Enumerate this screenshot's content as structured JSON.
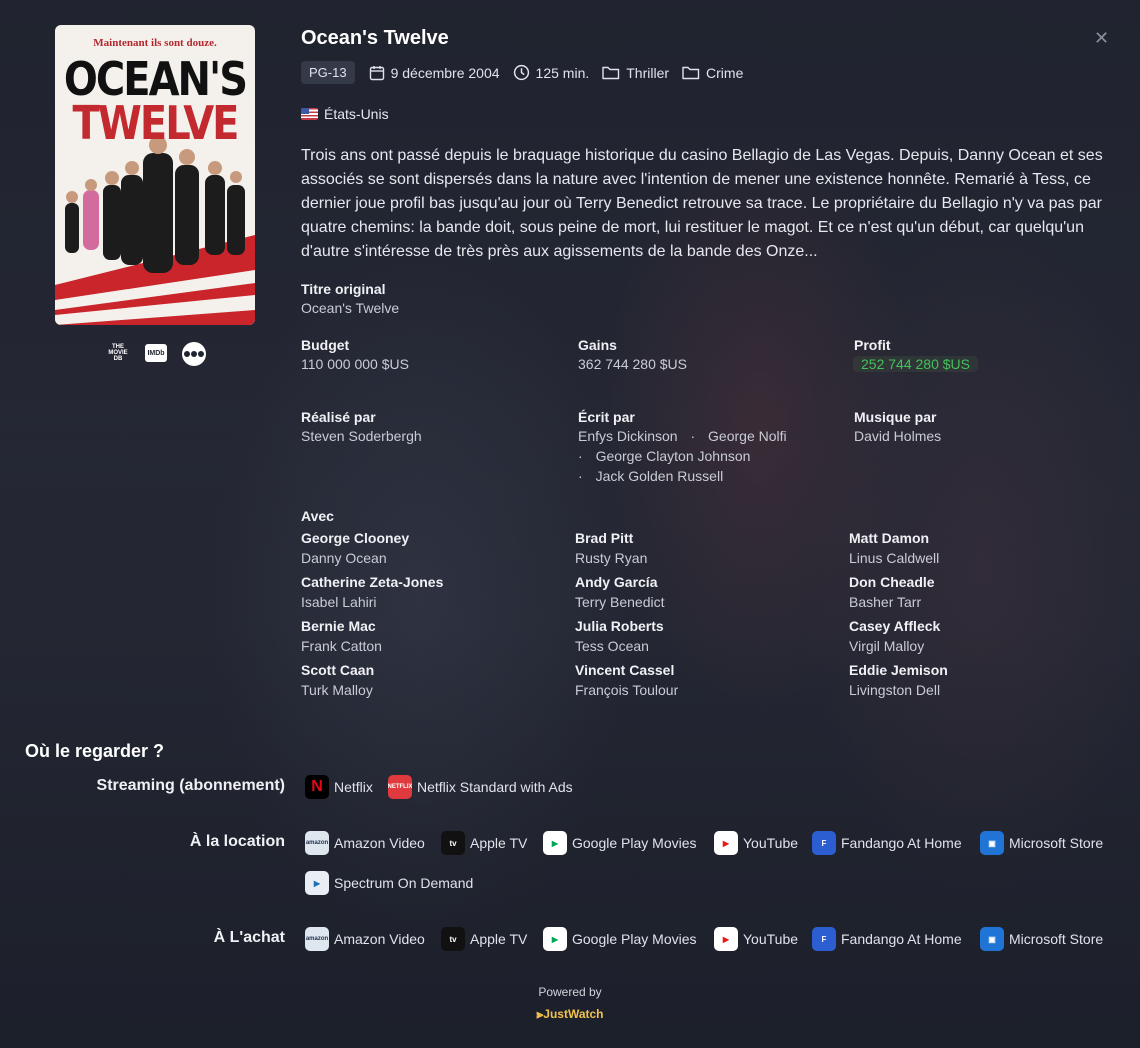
{
  "movie": {
    "title": "Ocean's Twelve",
    "certification": "PG-13",
    "release_date": "9 décembre 2004",
    "runtime": "125 min.",
    "genres": [
      "Thriller",
      "Crime"
    ],
    "country": "États-Unis",
    "overview": "Trois ans ont passé depuis le braquage historique du casino Bellagio de Las Vegas. Depuis, Danny Ocean et ses associés se sont dispersés dans la nature avec l'intention de mener une existence honnête. Remarié à Tess, ce dernier joue profil bas jusqu'au jour où Terry Benedict retrouve sa trace. Le propriétaire du Bellagio n'y va pas par quatre chemins: la bande doit, sous peine de mort, lui restituer le magot. Et ce n'est qu'un début, car quelqu'un d'autre s'intéresse de très près aux agissements de la bande des Onze..."
  },
  "poster": {
    "tagline": "Maintenant ils sont douze.",
    "title_line1": "OCEAN'S",
    "title_line2": "TWELVE"
  },
  "sources": [
    {
      "label": "THE MOVIE DB",
      "icon": "tmdb-icon"
    },
    {
      "label": "IMDb",
      "icon": "imdb-icon"
    },
    {
      "label": "",
      "icon": "letterboxd-icon"
    }
  ],
  "details": {
    "original_title_label": "Titre original",
    "original_title": "Ocean's Twelve",
    "budget_label": "Budget",
    "budget": "110 000 000 $US",
    "revenue_label": "Gains",
    "revenue": "362 744 280 $US",
    "profit_label": "Profit",
    "profit": "252 744 280 $US",
    "director_label": "Réalisé par",
    "director": "Steven Soderbergh",
    "writers_label": "Écrit par",
    "writers": [
      "Enfys Dickinson",
      "George Nolfi",
      "George Clayton Johnson",
      "Jack Golden Russell"
    ],
    "music_label": "Musique par",
    "music": "David Holmes",
    "separator": "·"
  },
  "cast": {
    "label": "Avec",
    "members": [
      {
        "name": "George Clooney",
        "character": "Danny Ocean"
      },
      {
        "name": "Brad Pitt",
        "character": "Rusty Ryan"
      },
      {
        "name": "Matt Damon",
        "character": "Linus Caldwell"
      },
      {
        "name": "Catherine Zeta-Jones",
        "character": "Isabel Lahiri"
      },
      {
        "name": "Andy García",
        "character": "Terry Benedict"
      },
      {
        "name": "Don Cheadle",
        "character": "Basher Tarr"
      },
      {
        "name": "Bernie Mac",
        "character": "Frank Catton"
      },
      {
        "name": "Julia Roberts",
        "character": "Tess Ocean"
      },
      {
        "name": "Casey Affleck",
        "character": "Virgil Malloy"
      },
      {
        "name": "Scott Caan",
        "character": "Turk Malloy"
      },
      {
        "name": "Vincent Cassel",
        "character": "François Toulour"
      },
      {
        "name": "Eddie Jemison",
        "character": "Livingston Dell"
      }
    ]
  },
  "watch": {
    "title": "Où le regarder ?",
    "streaming_label": "Streaming (abonnement)",
    "rent_label": "À la location",
    "buy_label": "À L'achat",
    "streaming": [
      {
        "name": "Netflix",
        "icon": "netflix-icon",
        "bg": "#000000",
        "fg": "#e50914",
        "glyph": "N"
      },
      {
        "name": "Netflix Standard with Ads",
        "icon": "netflix-ads-icon",
        "bg": "#e03a3e",
        "fg": "#ffffff",
        "glyph": "NETFLIX"
      }
    ],
    "rent": [
      {
        "name": "Amazon Video",
        "icon": "amazon-video-icon",
        "bg": "#dfe7ee",
        "fg": "#1a2e4a",
        "glyph": "amazon"
      },
      {
        "name": "Apple TV",
        "icon": "apple-tv-icon",
        "bg": "#111111",
        "fg": "#ffffff",
        "glyph": "tv"
      },
      {
        "name": "Google Play Movies",
        "icon": "google-play-icon",
        "bg": "#ffffff",
        "fg": "#01a85a",
        "glyph": "▶"
      },
      {
        "name": "YouTube",
        "icon": "youtube-icon",
        "bg": "#ffffff",
        "fg": "#e21b1b",
        "glyph": "▶"
      },
      {
        "name": "Fandango At Home",
        "icon": "fandango-icon",
        "bg": "#2c5ed1",
        "fg": "#ffffff",
        "glyph": "F"
      },
      {
        "name": "Microsoft Store",
        "icon": "microsoft-store-icon",
        "bg": "#1f74d6",
        "fg": "#ffffff",
        "glyph": "▣"
      },
      {
        "name": "Spectrum On Demand",
        "icon": "spectrum-icon",
        "bg": "#e8eef4",
        "fg": "#1f6fb5",
        "glyph": "▶"
      }
    ],
    "buy": [
      {
        "name": "Amazon Video",
        "icon": "amazon-video-icon",
        "bg": "#dfe7ee",
        "fg": "#1a2e4a",
        "glyph": "amazon"
      },
      {
        "name": "Apple TV",
        "icon": "apple-tv-icon",
        "bg": "#111111",
        "fg": "#ffffff",
        "glyph": "tv"
      },
      {
        "name": "Google Play Movies",
        "icon": "google-play-icon",
        "bg": "#ffffff",
        "fg": "#01a85a",
        "glyph": "▶"
      },
      {
        "name": "YouTube",
        "icon": "youtube-icon",
        "bg": "#ffffff",
        "fg": "#e21b1b",
        "glyph": "▶"
      },
      {
        "name": "Fandango At Home",
        "icon": "fandango-icon",
        "bg": "#2c5ed1",
        "fg": "#ffffff",
        "glyph": "F"
      },
      {
        "name": "Microsoft Store",
        "icon": "microsoft-store-icon",
        "bg": "#1f74d6",
        "fg": "#ffffff",
        "glyph": "▣"
      }
    ]
  },
  "footer": {
    "powered_by": "Powered by",
    "provider": "JustWatch"
  },
  "colors": {
    "profit": "#44c15a",
    "background": "#1e2330",
    "justwatch": "#f2c14e"
  }
}
